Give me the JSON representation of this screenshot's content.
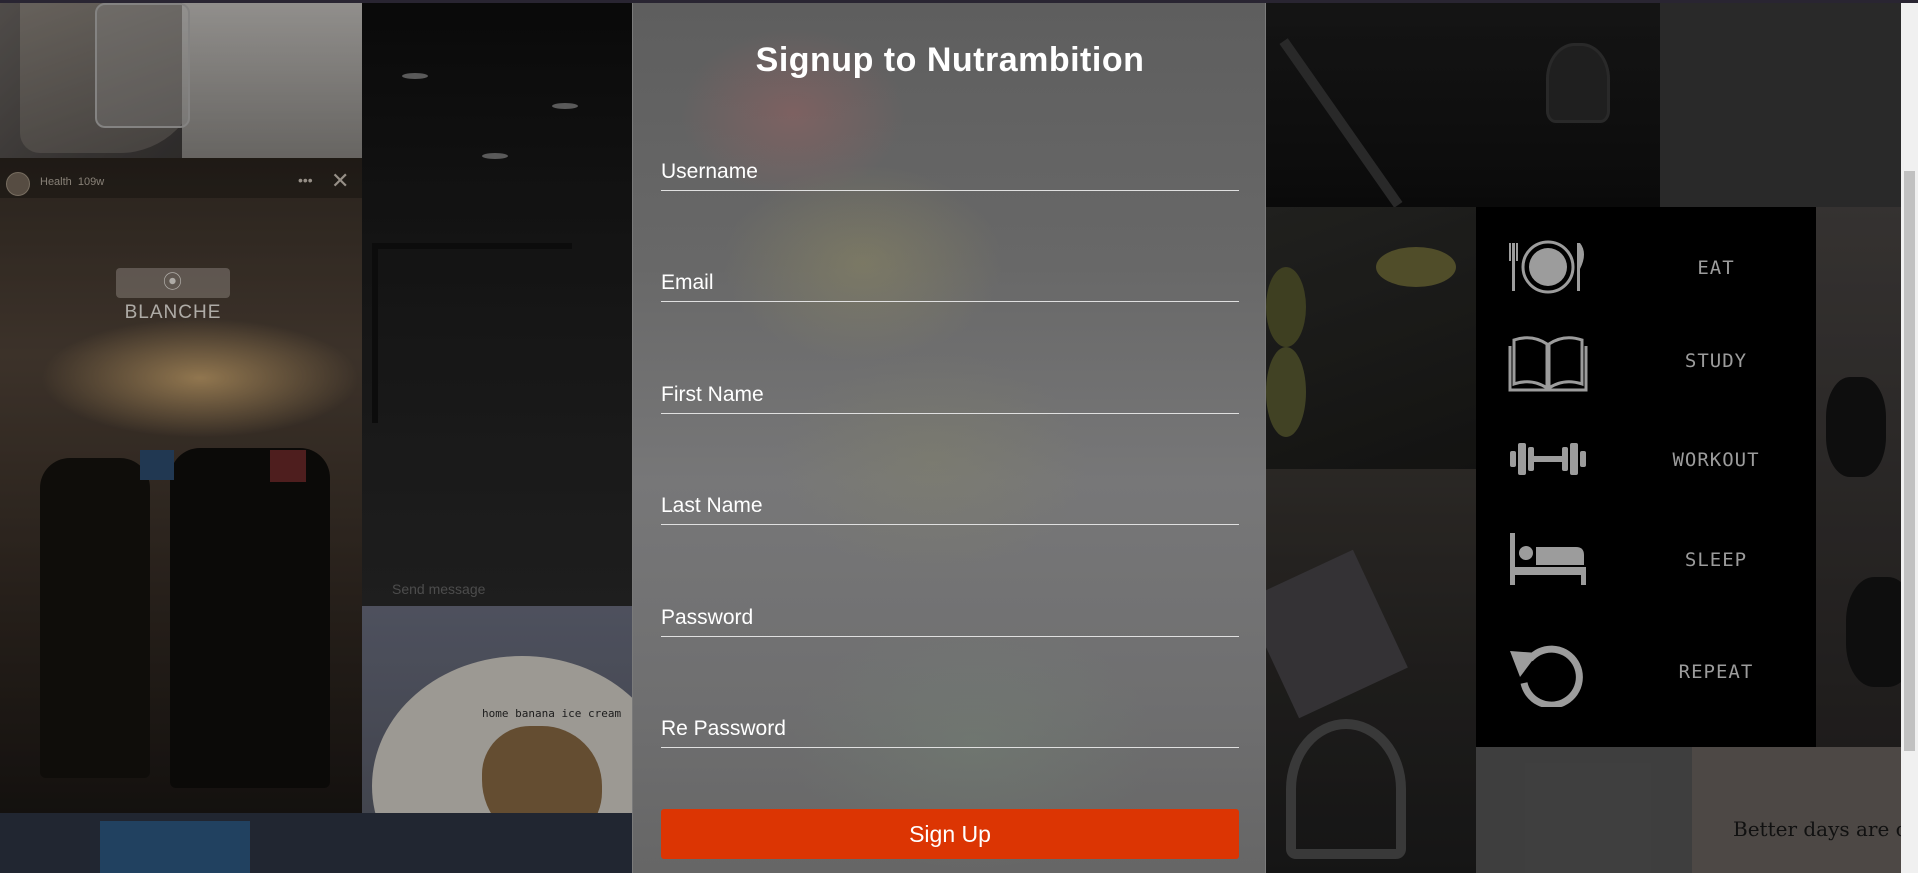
{
  "form": {
    "title": "Signup to Nutrambition",
    "fields": {
      "username": "Username",
      "email": "Email",
      "first_name": "First Name",
      "last_name": "Last Name",
      "password": "Password",
      "re_password": "Re Password"
    },
    "submit_label": "Sign Up"
  },
  "colors": {
    "accent": "#dc3503",
    "title_text": "#ffffff"
  },
  "background": {
    "story_user": "Health",
    "story_age": "109w",
    "location_tag": "BLANCHE",
    "send_message": "Send message",
    "food_caption": "home banana ice cream",
    "quote": "Better days are c",
    "routine": [
      {
        "icon": "plate-cutlery-icon",
        "label": "EAT"
      },
      {
        "icon": "book-icon",
        "label": "STUDY"
      },
      {
        "icon": "dumbbell-icon",
        "label": "WORKOUT"
      },
      {
        "icon": "bed-icon",
        "label": "SLEEP"
      },
      {
        "icon": "repeat-icon",
        "label": "REPEAT"
      }
    ]
  }
}
